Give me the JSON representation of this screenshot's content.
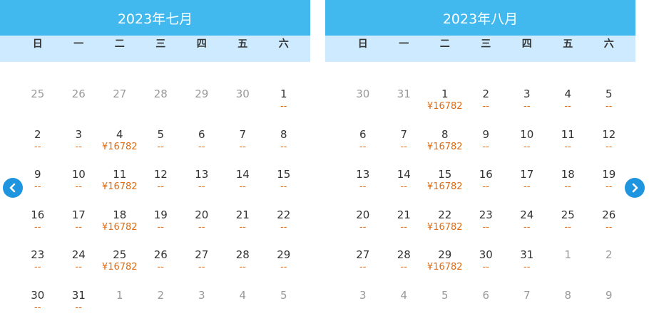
{
  "weekdays": [
    "日",
    "一",
    "二",
    "三",
    "四",
    "五",
    "六"
  ],
  "nav": {
    "prev_icon": "chevron-left-icon",
    "next_icon": "chevron-right-icon"
  },
  "months": [
    {
      "title": "2023年七月",
      "days": [
        {
          "d": "25",
          "p": "",
          "other": true
        },
        {
          "d": "26",
          "p": "",
          "other": true
        },
        {
          "d": "27",
          "p": "",
          "other": true
        },
        {
          "d": "28",
          "p": "",
          "other": true
        },
        {
          "d": "29",
          "p": "",
          "other": true
        },
        {
          "d": "30",
          "p": "",
          "other": true
        },
        {
          "d": "1",
          "p": "--"
        },
        {
          "d": "2",
          "p": "--"
        },
        {
          "d": "3",
          "p": "--"
        },
        {
          "d": "4",
          "p": "¥16782"
        },
        {
          "d": "5",
          "p": "--"
        },
        {
          "d": "6",
          "p": "--"
        },
        {
          "d": "7",
          "p": "--"
        },
        {
          "d": "8",
          "p": "--"
        },
        {
          "d": "9",
          "p": "--"
        },
        {
          "d": "10",
          "p": "--"
        },
        {
          "d": "11",
          "p": "¥16782"
        },
        {
          "d": "12",
          "p": "--"
        },
        {
          "d": "13",
          "p": "--"
        },
        {
          "d": "14",
          "p": "--"
        },
        {
          "d": "15",
          "p": "--"
        },
        {
          "d": "16",
          "p": "--"
        },
        {
          "d": "17",
          "p": "--"
        },
        {
          "d": "18",
          "p": "¥16782"
        },
        {
          "d": "19",
          "p": "--"
        },
        {
          "d": "20",
          "p": "--"
        },
        {
          "d": "21",
          "p": "--"
        },
        {
          "d": "22",
          "p": "--"
        },
        {
          "d": "23",
          "p": "--"
        },
        {
          "d": "24",
          "p": "--"
        },
        {
          "d": "25",
          "p": "¥16782"
        },
        {
          "d": "26",
          "p": "--"
        },
        {
          "d": "27",
          "p": "--"
        },
        {
          "d": "28",
          "p": "--"
        },
        {
          "d": "29",
          "p": "--"
        },
        {
          "d": "30",
          "p": "--"
        },
        {
          "d": "31",
          "p": "--"
        },
        {
          "d": "1",
          "p": "",
          "other": true
        },
        {
          "d": "2",
          "p": "",
          "other": true
        },
        {
          "d": "3",
          "p": "",
          "other": true
        },
        {
          "d": "4",
          "p": "",
          "other": true
        },
        {
          "d": "5",
          "p": "",
          "other": true
        }
      ]
    },
    {
      "title": "2023年八月",
      "days": [
        {
          "d": "30",
          "p": "",
          "other": true
        },
        {
          "d": "31",
          "p": "",
          "other": true
        },
        {
          "d": "1",
          "p": "¥16782"
        },
        {
          "d": "2",
          "p": "--"
        },
        {
          "d": "3",
          "p": "--"
        },
        {
          "d": "4",
          "p": "--"
        },
        {
          "d": "5",
          "p": "--"
        },
        {
          "d": "6",
          "p": "--"
        },
        {
          "d": "7",
          "p": "--"
        },
        {
          "d": "8",
          "p": "¥16782"
        },
        {
          "d": "9",
          "p": "--"
        },
        {
          "d": "10",
          "p": "--"
        },
        {
          "d": "11",
          "p": "--"
        },
        {
          "d": "12",
          "p": "--"
        },
        {
          "d": "13",
          "p": "--"
        },
        {
          "d": "14",
          "p": "--"
        },
        {
          "d": "15",
          "p": "¥16782"
        },
        {
          "d": "16",
          "p": "--"
        },
        {
          "d": "17",
          "p": "--"
        },
        {
          "d": "18",
          "p": "--"
        },
        {
          "d": "19",
          "p": "--"
        },
        {
          "d": "20",
          "p": "--"
        },
        {
          "d": "21",
          "p": "--"
        },
        {
          "d": "22",
          "p": "¥16782"
        },
        {
          "d": "23",
          "p": "--"
        },
        {
          "d": "24",
          "p": "--"
        },
        {
          "d": "25",
          "p": "--"
        },
        {
          "d": "26",
          "p": "--"
        },
        {
          "d": "27",
          "p": "--"
        },
        {
          "d": "28",
          "p": "--"
        },
        {
          "d": "29",
          "p": "¥16782"
        },
        {
          "d": "30",
          "p": "--"
        },
        {
          "d": "31",
          "p": "--"
        },
        {
          "d": "1",
          "p": "",
          "other": true
        },
        {
          "d": "2",
          "p": "",
          "other": true
        },
        {
          "d": "3",
          "p": "",
          "other": true
        },
        {
          "d": "4",
          "p": "",
          "other": true
        },
        {
          "d": "5",
          "p": "",
          "other": true
        },
        {
          "d": "6",
          "p": "",
          "other": true
        },
        {
          "d": "7",
          "p": "",
          "other": true
        },
        {
          "d": "8",
          "p": "",
          "other": true
        },
        {
          "d": "9",
          "p": "",
          "other": true
        }
      ]
    }
  ],
  "colors": {
    "header": "#41b9ee",
    "weekday_bar": "#cdeafe",
    "price": "#e06b13",
    "nav": "#1e95de"
  }
}
